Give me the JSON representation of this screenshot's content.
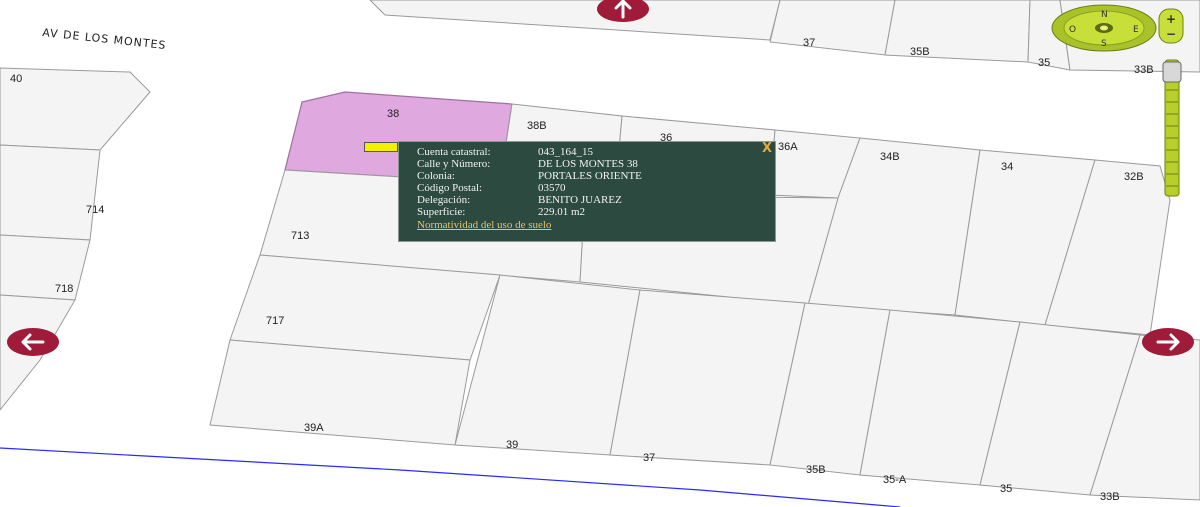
{
  "street": {
    "name": "AV DE LOS MONTES"
  },
  "lots": {
    "top_row": [
      "37",
      "35B",
      "35",
      "33B"
    ],
    "block": [
      "40",
      "38",
      "38B",
      "36",
      "36A",
      "34B",
      "34",
      "32B",
      "714",
      "713",
      "718",
      "717",
      "39A",
      "39",
      "37",
      "35B",
      "35-A",
      "35",
      "33B"
    ]
  },
  "popup": {
    "fields": [
      {
        "label": "Cuenta catastral:",
        "value": "043_164_15"
      },
      {
        "label": "Calle y Número:",
        "value": "DE LOS MONTES 38"
      },
      {
        "label": "Colonia:",
        "value": "PORTALES ORIENTE"
      },
      {
        "label": "Código Postal:",
        "value": "03570"
      },
      {
        "label": "Delegación:",
        "value": "BENITO JUAREZ"
      },
      {
        "label": "Superficie:",
        "value": "229.01 m2"
      }
    ],
    "link": "Normatividad del uso de suelo",
    "close_glyph": "X"
  },
  "compass": {
    "n": "N",
    "s": "S",
    "e": "E",
    "o": "O"
  },
  "zoom": {
    "plus": "+",
    "minus": "−"
  },
  "colors": {
    "selected_lot": "#dfa8df",
    "popup_bg": "#2c4a40",
    "pan_button": "#a01a3a",
    "nav_green": "#c8df3a"
  }
}
